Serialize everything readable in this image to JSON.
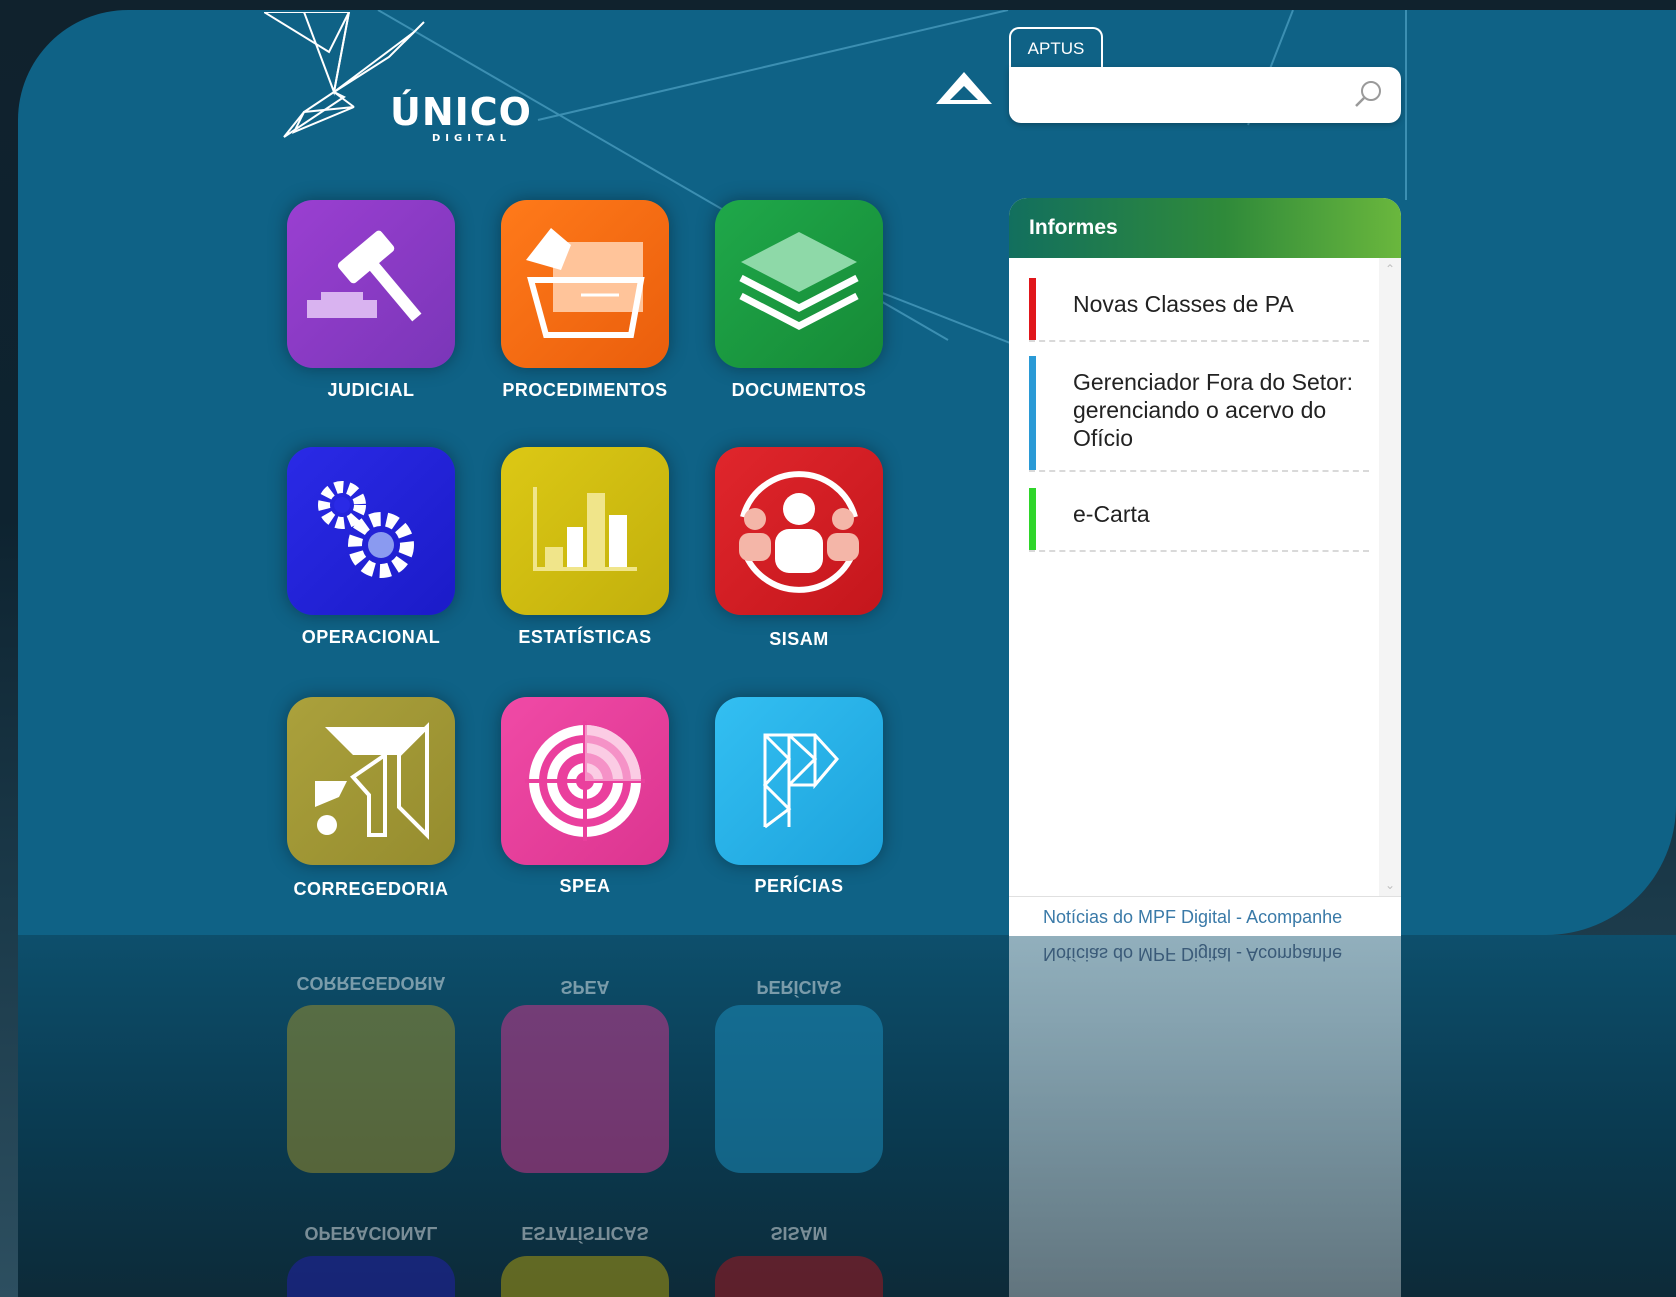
{
  "brand": {
    "name": "ÚNICO",
    "subtitle": "DIGITAL"
  },
  "apps": [
    {
      "label": "JUDICIAL",
      "color": "#8a3dc4",
      "icon": "gavel-icon"
    },
    {
      "label": "PROCEDIMENTOS",
      "color": "#f06a12",
      "icon": "folder-hand-icon"
    },
    {
      "label": "DOCUMENTOS",
      "color": "#1a9a3e",
      "icon": "layers-icon"
    },
    {
      "label": "OPERACIONAL",
      "color": "#2020d8",
      "icon": "gears-icon"
    },
    {
      "label": "ESTATÍSTICAS",
      "color": "#d4bf10",
      "icon": "bar-chart-icon"
    },
    {
      "label": "SISAM",
      "color": "#d41f26",
      "icon": "people-group-icon"
    },
    {
      "label": "CORREGEDORIA",
      "color": "#a39a35",
      "icon": "corregedoria-logo-icon"
    },
    {
      "label": "SPEA",
      "color": "#ea3f9d",
      "icon": "target-icon"
    },
    {
      "label": "PERÍCIAS",
      "color": "#27b1e8",
      "icon": "pericias-logo-icon"
    }
  ],
  "search": {
    "tab_label": "APTUS",
    "value": "",
    "placeholder": ""
  },
  "informes": {
    "title": "Informes",
    "items": [
      {
        "text": "Novas Classes de PA",
        "color": "#e0161b"
      },
      {
        "text": "Gerenciador Fora do Setor: gerenciando o acervo do Ofício",
        "color": "#2a9ad6"
      },
      {
        "text": "e-Carta",
        "color": "#2fd52a"
      }
    ],
    "footer": "Notícias do MPF Digital - Acompanhe"
  }
}
